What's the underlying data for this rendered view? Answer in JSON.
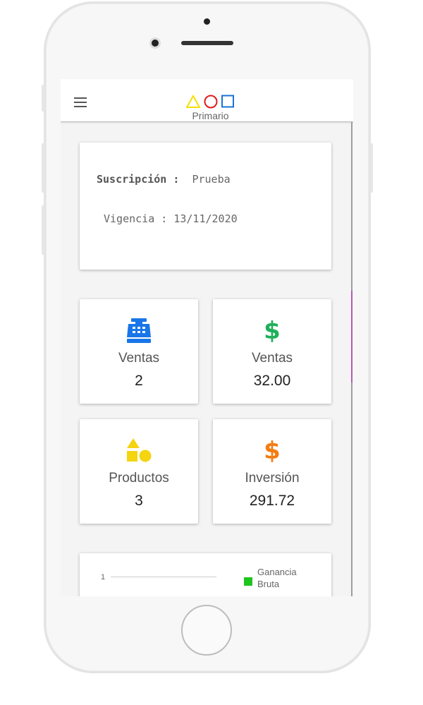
{
  "app": {
    "title": "Primario"
  },
  "subscription": {
    "label": "Suscripción :",
    "value": "Prueba",
    "validity_label": "Vigencia :",
    "validity_value": "13/11/2020"
  },
  "stats": [
    {
      "icon": "cash-register-icon",
      "label": "Ventas",
      "value": "2",
      "color": "#1976e8"
    },
    {
      "icon": "dollar-icon",
      "symbol": "$",
      "label": "Ventas",
      "value": "32.00",
      "color": "#1fb05a"
    },
    {
      "icon": "shapes-icon",
      "label": "Productos",
      "value": "3",
      "color": "#f5d410"
    },
    {
      "icon": "dollar-icon",
      "symbol": "$",
      "label": "Inversión",
      "value": "291.72",
      "color": "#f57c10"
    }
  ],
  "chart_data": {
    "type": "bar",
    "categories": [],
    "series": [
      {
        "name": "Ganancia Bruta",
        "values": []
      }
    ],
    "yticks": [
      "1"
    ],
    "legend": "top-right",
    "colors": {
      "Ganancia Bruta": "#1fc51f"
    }
  },
  "logo_colors": {
    "triangle": "#f5e000",
    "circle": "#e01b1b",
    "square": "#1a73d6"
  }
}
